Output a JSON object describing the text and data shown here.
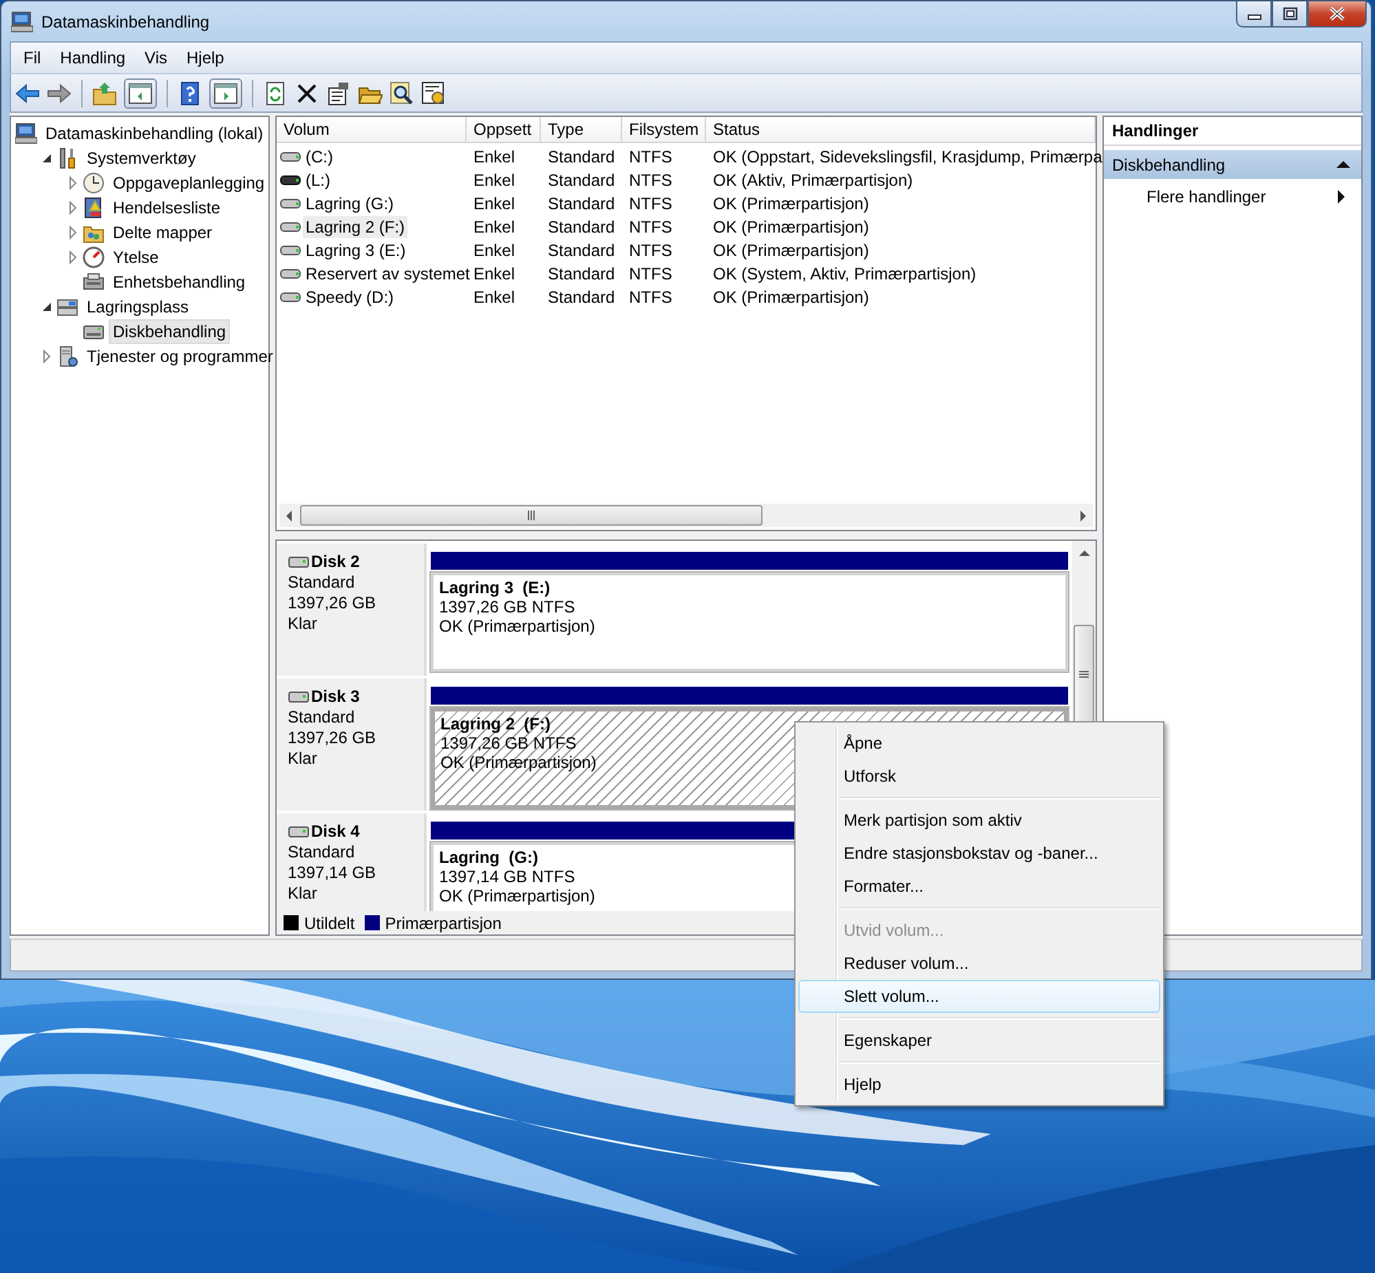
{
  "window": {
    "title": "Datamaskinbehandling"
  },
  "menu_bar": [
    "Fil",
    "Handling",
    "Vis",
    "Hjelp"
  ],
  "tree": {
    "label": "Datamaskinbehandling (lokal)",
    "selected": false,
    "children": [
      {
        "label": "Systemverktøy",
        "expanded": true,
        "selected": false,
        "children": [
          {
            "label": "Oppgaveplanlegging",
            "expanded": false,
            "selected": false
          },
          {
            "label": "Hendelsesliste",
            "expanded": false,
            "selected": false
          },
          {
            "label": "Delte mapper",
            "expanded": false,
            "selected": false
          },
          {
            "label": "Ytelse",
            "expanded": false,
            "selected": false
          },
          {
            "label": "Enhetsbehandling",
            "selected": false
          }
        ]
      },
      {
        "label": "Lagringsplass",
        "expanded": true,
        "selected": false,
        "children": [
          {
            "label": "Diskbehandling",
            "selected": true
          }
        ]
      },
      {
        "label": "Tjenester og programmer",
        "expanded": false,
        "selected": false
      }
    ]
  },
  "volumes": {
    "columns": [
      "Volum",
      "Oppsett",
      "Type",
      "Filsystem",
      "Status"
    ],
    "rows": [
      {
        "kind": "standard",
        "selected": false,
        "cells": [
          "(C:)",
          "Enkel",
          "Standard",
          "NTFS",
          "OK (Oppstart, Sidevekslingsfil, Krasjdump, Primærpa"
        ]
      },
      {
        "kind": "dark",
        "selected": false,
        "cells": [
          "(L:)",
          "Enkel",
          "Standard",
          "NTFS",
          "OK (Aktiv, Primærpartisjon)"
        ]
      },
      {
        "kind": "standard",
        "selected": false,
        "cells": [
          "Lagring (G:)",
          "Enkel",
          "Standard",
          "NTFS",
          "OK (Primærpartisjon)"
        ]
      },
      {
        "kind": "standard",
        "selected": true,
        "cells": [
          "Lagring 2 (F:)",
          "Enkel",
          "Standard",
          "NTFS",
          "OK (Primærpartisjon)"
        ]
      },
      {
        "kind": "standard",
        "selected": false,
        "cells": [
          "Lagring 3 (E:)",
          "Enkel",
          "Standard",
          "NTFS",
          "OK (Primærpartisjon)"
        ]
      },
      {
        "kind": "standard",
        "selected": false,
        "cells": [
          "Reservert av systemet",
          "Enkel",
          "Standard",
          "NTFS",
          "OK (System, Aktiv, Primærpartisjon)"
        ]
      },
      {
        "kind": "standard",
        "selected": false,
        "cells": [
          "Speedy (D:)",
          "Enkel",
          "Standard",
          "NTFS",
          "OK (Primærpartisjon)"
        ]
      }
    ]
  },
  "disks": [
    {
      "name": "Disk 2",
      "type": "Standard",
      "size": "1397,26 GB",
      "state": "Klar",
      "partition": {
        "name": "Lagring 3  (E:)",
        "size": "1397,26 GB NTFS",
        "status": "OK (Primærpartisjon)",
        "selected": false
      }
    },
    {
      "name": "Disk 3",
      "type": "Standard",
      "size": "1397,26 GB",
      "state": "Klar",
      "partition": {
        "name": "Lagring 2  (F:)",
        "size": "1397,26 GB NTFS",
        "status": "OK (Primærpartisjon)",
        "selected": true
      }
    },
    {
      "name": "Disk 4",
      "type": "Standard",
      "size": "1397,14 GB",
      "state": "Klar",
      "partition": {
        "name": "Lagring  (G:)",
        "size": "1397,14 GB NTFS",
        "status": "OK (Primærpartisjon)",
        "selected": false
      }
    }
  ],
  "legend": [
    {
      "label": "Utildelt",
      "color": "#000000"
    },
    {
      "label": "Primærpartisjon",
      "color": "#000080"
    }
  ],
  "actions": {
    "title": "Handlinger",
    "section": {
      "label": "Diskbehandling",
      "expanded": true
    },
    "items": [
      "Flere handlinger"
    ]
  },
  "context_menu": [
    {
      "kind": "item",
      "label": "Åpne",
      "disabled": false,
      "selected": false
    },
    {
      "kind": "item",
      "label": "Utforsk",
      "disabled": false,
      "selected": false
    },
    {
      "kind": "separator"
    },
    {
      "kind": "item",
      "label": "Merk partisjon som aktiv",
      "disabled": false,
      "selected": false
    },
    {
      "kind": "item",
      "label": "Endre stasjonsbokstav og -baner...",
      "disabled": false,
      "selected": false
    },
    {
      "kind": "item",
      "label": "Formater...",
      "disabled": false,
      "selected": false
    },
    {
      "kind": "separator"
    },
    {
      "kind": "item",
      "label": "Utvid volum...",
      "disabled": true,
      "selected": false
    },
    {
      "kind": "item",
      "label": "Reduser volum...",
      "disabled": false,
      "selected": false
    },
    {
      "kind": "item",
      "label": "Slett volum...",
      "disabled": false,
      "selected": true
    },
    {
      "kind": "separator"
    },
    {
      "kind": "item",
      "label": "Egenskaper",
      "disabled": false,
      "selected": false
    },
    {
      "kind": "separator"
    },
    {
      "kind": "item",
      "label": "Hjelp",
      "disabled": false,
      "selected": false
    }
  ]
}
